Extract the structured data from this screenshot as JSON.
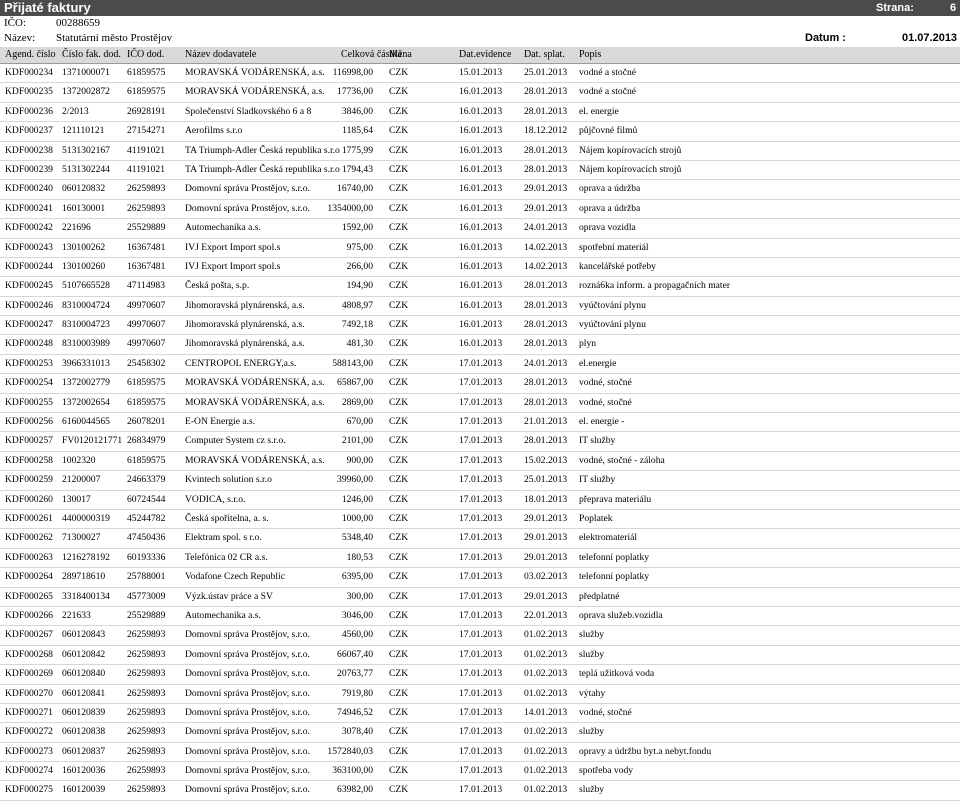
{
  "header": {
    "title": "Přijaté faktury",
    "page_label": "Strana:",
    "page_value": "6",
    "ico_label": "IČO:",
    "ico_value": "00288659",
    "name_label": "Název:",
    "name_value": "Statutární město Prostějov",
    "date_label": "Datum :",
    "date_value": "01.07.2013"
  },
  "columns": [
    "Agend. číslo",
    "Číslo fak. dod.",
    "IČO dod.",
    "Název dodavatele",
    "Celková částka",
    "Měna",
    "Dat.evidence",
    "Dat. splat.",
    "Popis"
  ],
  "rows": [
    [
      "KDF000234",
      "1371000071",
      "61859575",
      "MORAVSKÁ VODÁRENSKÁ, a.s.",
      "116998,00",
      "CZK",
      "15.01.2013",
      "25.01.2013",
      "vodné a stočné"
    ],
    [
      "KDF000235",
      "1372002872",
      "61859575",
      "MORAVSKÁ VODÁRENSKÁ, a.s.",
      "17736,00",
      "CZK",
      "16.01.2013",
      "28.01.2013",
      "vodné a stočné"
    ],
    [
      "KDF000236",
      "2/2013",
      "26928191",
      "Společenství Sladkovského 6 a 8",
      "3846,00",
      "CZK",
      "16.01.2013",
      "28.01.2013",
      "el. energie"
    ],
    [
      "KDF000237",
      "121110121",
      "27154271",
      "Aerofilms s.r.o",
      "1185,64",
      "CZK",
      "16.01.2013",
      "18.12.2012",
      "půjčovné filmů"
    ],
    [
      "KDF000238",
      "5131302167",
      "41191021",
      "TA Triumph-Adler Česká republika s.r.o",
      "1775,99",
      "CZK",
      "16.01.2013",
      "28.01.2013",
      "Nájem kopírovacích strojů"
    ],
    [
      "KDF000239",
      "5131302244",
      "41191021",
      "TA Triumph-Adler Česká republika s.r.o",
      "1794,43",
      "CZK",
      "16.01.2013",
      "28.01.2013",
      "Nájem kopírovacích strojů"
    ],
    [
      "KDF000240",
      "060120832",
      "26259893",
      "Domovní správa Prostějov, s.r.o.",
      "16740,00",
      "CZK",
      "16.01.2013",
      "29.01.2013",
      "oprava a údržba"
    ],
    [
      "KDF000241",
      "160130001",
      "26259893",
      "Domovní správa Prostějov, s.r.o.",
      "1354000,00",
      "CZK",
      "16.01.2013",
      "29.01.2013",
      "oprava a údržba"
    ],
    [
      "KDF000242",
      "221696",
      "25529889",
      "Automechanika a.s.",
      "1592,00",
      "CZK",
      "16.01.2013",
      "24.01.2013",
      "oprava vozidla"
    ],
    [
      "KDF000243",
      "130100262",
      "16367481",
      "IVJ Export Import spol.s",
      "975,00",
      "CZK",
      "16.01.2013",
      "14.02.2013",
      "spotřební materiál"
    ],
    [
      "KDF000244",
      "130100260",
      "16367481",
      "IVJ Export Import spol.s",
      "266,00",
      "CZK",
      "16.01.2013",
      "14.02.2013",
      "kancelářské potřeby"
    ],
    [
      "KDF000245",
      "5107665528",
      "47114983",
      "Česká pošta, s.p.",
      "194,90",
      "CZK",
      "16.01.2013",
      "28.01.2013",
      "rozná6ka inform. a propagačních mater"
    ],
    [
      "KDF000246",
      "8310004724",
      "49970607",
      "Jihomoravská plynárenská, a.s.",
      "4808,97",
      "CZK",
      "16.01.2013",
      "28.01.2013",
      "vyúčtování plynu"
    ],
    [
      "KDF000247",
      "8310004723",
      "49970607",
      "Jihomoravská plynárenská, a.s.",
      "7492,18",
      "CZK",
      "16.01.2013",
      "28.01.2013",
      "vyúčtování plynu"
    ],
    [
      "KDF000248",
      "8310003989",
      "49970607",
      "Jihomoravská plynárenská, a.s.",
      "481,30",
      "CZK",
      "16.01.2013",
      "28.01.2013",
      "plyn"
    ],
    [
      "KDF000253",
      "3966331013",
      "25458302",
      "CENTROPOL ENERGY,a.s.",
      "588143,00",
      "CZK",
      "17.01.2013",
      "24.01.2013",
      "el.energie"
    ],
    [
      "KDF000254",
      "1372002779",
      "61859575",
      "MORAVSKÁ VODÁRENSKÁ, a.s.",
      "65867,00",
      "CZK",
      "17.01.2013",
      "28.01.2013",
      "vodné, stočné"
    ],
    [
      "KDF000255",
      "1372002654",
      "61859575",
      "MORAVSKÁ VODÁRENSKÁ, a.s.",
      "2869,00",
      "CZK",
      "17.01.2013",
      "28.01.2013",
      "vodné, stočné"
    ],
    [
      "KDF000256",
      "6160044565",
      "26078201",
      "E-ON Energie a.s.",
      "670,00",
      "CZK",
      "17.01.2013",
      "21.01.2013",
      "el. energie -"
    ],
    [
      "KDF000257",
      "FV0120121771",
      "26834979",
      "Computer System cz s.r.o.",
      "2101,00",
      "CZK",
      "17.01.2013",
      "28.01.2013",
      "IT služby"
    ],
    [
      "KDF000258",
      "1002320",
      "61859575",
      "MORAVSKÁ VODÁRENSKÁ, a.s.",
      "900,00",
      "CZK",
      "17.01.2013",
      "15.02.2013",
      "vodné, stočné - záloha"
    ],
    [
      "KDF000259",
      "21200007",
      "24663379",
      "Kvintech solution s.r.o",
      "39960,00",
      "CZK",
      "17.01.2013",
      "25.01.2013",
      "IT služby"
    ],
    [
      "KDF000260",
      "130017",
      "60724544",
      "VODICA, s.r.o.",
      "1246,00",
      "CZK",
      "17.01.2013",
      "18.01.2013",
      "přeprava materiálu"
    ],
    [
      "KDF000261",
      "4400000319",
      "45244782",
      "Česká spořitelna, a. s.",
      "1000,00",
      "CZK",
      "17.01.2013",
      "29.01.2013",
      "Poplatek"
    ],
    [
      "KDF000262",
      "71300027",
      "47450436",
      "Elektram spol. s r.o.",
      "5348,40",
      "CZK",
      "17.01.2013",
      "29.01.2013",
      "elektromateriál"
    ],
    [
      "KDF000263",
      "1216278192",
      "60193336",
      "Telefónica 02 CR a.s.",
      "180,53",
      "CZK",
      "17.01.2013",
      "29.01.2013",
      "telefonní poplatky"
    ],
    [
      "KDF000264",
      "289718610",
      "25788001",
      "Vodafone Czech Republic",
      "6395,00",
      "CZK",
      "17.01.2013",
      "03.02.2013",
      "telefonní poplatky"
    ],
    [
      "KDF000265",
      "3318400134",
      "45773009",
      "Výzk.ústav práce a SV",
      "300,00",
      "CZK",
      "17.01.2013",
      "29.01.2013",
      "předplatné"
    ],
    [
      "KDF000266",
      "221633",
      "25529889",
      "Automechanika a.s.",
      "3046,00",
      "CZK",
      "17.01.2013",
      "22.01.2013",
      "oprava služeb.vozidla"
    ],
    [
      "KDF000267",
      "060120843",
      "26259893",
      "Domovní správa Prostějov, s.r.o.",
      "4560,00",
      "CZK",
      "17.01.2013",
      "01.02.2013",
      "služby"
    ],
    [
      "KDF000268",
      "060120842",
      "26259893",
      "Domovní správa Prostějov, s.r.o.",
      "66067,40",
      "CZK",
      "17.01.2013",
      "01.02.2013",
      "služby"
    ],
    [
      "KDF000269",
      "060120840",
      "26259893",
      "Domovní správa Prostějov, s.r.o.",
      "20763,77",
      "CZK",
      "17.01.2013",
      "01.02.2013",
      "teplá užitková voda"
    ],
    [
      "KDF000270",
      "060120841",
      "26259893",
      "Domovní správa Prostějov, s.r.o.",
      "7919,80",
      "CZK",
      "17.01.2013",
      "01.02.2013",
      "výtahy"
    ],
    [
      "KDF000271",
      "060120839",
      "26259893",
      "Domovní správa Prostějov, s.r.o.",
      "74946,52",
      "CZK",
      "17.01.2013",
      "14.01.2013",
      "vodné, stočné"
    ],
    [
      "KDF000272",
      "060120838",
      "26259893",
      "Domovní správa Prostějov, s.r.o.",
      "3078,40",
      "CZK",
      "17.01.2013",
      "01.02.2013",
      "služby"
    ],
    [
      "KDF000273",
      "060120837",
      "26259893",
      "Domovní správa Prostějov, s.r.o.",
      "1572840,03",
      "CZK",
      "17.01.2013",
      "01.02.2013",
      "opravy   a údržbu byt.a nebyt.fondu"
    ],
    [
      "KDF000274",
      "160120036",
      "26259893",
      "Domovní správa Prostějov, s.r.o.",
      "363100,00",
      "CZK",
      "17.01.2013",
      "01.02.2013",
      "spotřeba vody"
    ],
    [
      "KDF000275",
      "160120039",
      "26259893",
      "Domovní správa Prostějov, s.r.o.",
      "63982,00",
      "CZK",
      "17.01.2013",
      "01.02.2013",
      "služby"
    ]
  ]
}
